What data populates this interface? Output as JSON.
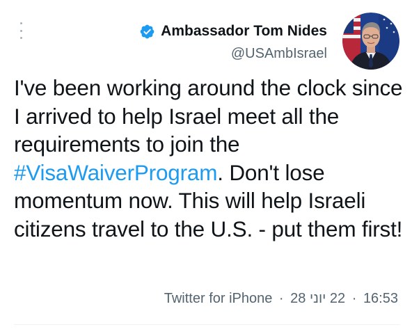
{
  "author": {
    "display_name": "Ambassador Tom Nides",
    "handle": "@USAmbIsrael",
    "verified": true
  },
  "tweet": {
    "text_part1": "I've been working around the clock since I arrived to help Israel meet all the requirements to join the ",
    "hashtag": "#VisaWaiverProgram",
    "text_part2": ". Don't lose momentum now. This will help Israeli citizens travel to the U.S. - put them first!"
  },
  "meta": {
    "source": "Twitter for iPhone",
    "separator": "·",
    "date": "22 יוני 28",
    "time": "16:53"
  },
  "icons": {
    "more": "more-vertical-icon",
    "verified": "verified-badge-icon"
  },
  "colors": {
    "accent": "#1d9bf0",
    "secondary_text": "#536471",
    "primary_text": "#0f1419"
  }
}
